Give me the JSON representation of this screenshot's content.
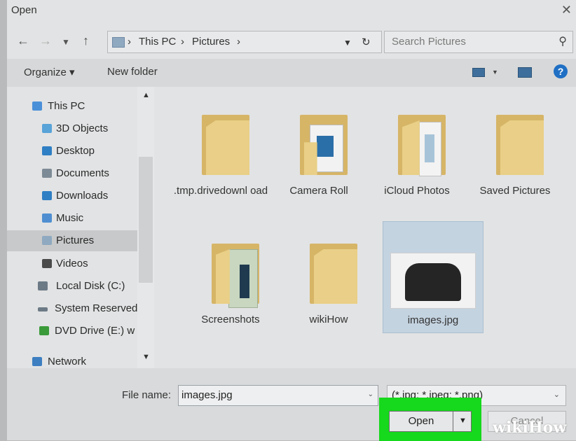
{
  "window": {
    "title": "Open"
  },
  "nav": {
    "breadcrumb": [
      "This PC",
      "Pictures"
    ],
    "search_placeholder": "Search Pictures"
  },
  "toolbar": {
    "organize": "Organize ▾",
    "new_folder": "New folder"
  },
  "sidebar": {
    "items": [
      {
        "label": "This PC",
        "icon": "computer-icon",
        "color": "#4a90d9"
      },
      {
        "label": "3D Objects",
        "icon": "cube-icon",
        "color": "#58a3d8"
      },
      {
        "label": "Desktop",
        "icon": "desktop-icon",
        "color": "#2f7fc4"
      },
      {
        "label": "Documents",
        "icon": "documents-icon",
        "color": "#7d8b96"
      },
      {
        "label": "Downloads",
        "icon": "download-icon",
        "color": "#2f7fc4"
      },
      {
        "label": "Music",
        "icon": "music-icon",
        "color": "#4f8fd1"
      },
      {
        "label": "Pictures",
        "icon": "pictures-icon",
        "color": "#8fa9c0"
      },
      {
        "label": "Videos",
        "icon": "videos-icon",
        "color": "#4a4a4a"
      },
      {
        "label": "Local Disk (C:)",
        "icon": "disk-icon",
        "color": "#6c7a86"
      },
      {
        "label": "System Reserved",
        "icon": "drive-icon",
        "color": "#6c7a86"
      },
      {
        "label": "DVD Drive (E:) w",
        "icon": "dvd-icon",
        "color": "#3a9a3a"
      },
      {
        "label": "Network",
        "icon": "network-icon",
        "color": "#3d7fc1"
      }
    ]
  },
  "files": [
    {
      "name": ".tmp.drivedownl oad",
      "type": "folder"
    },
    {
      "name": "Camera Roll",
      "type": "folder"
    },
    {
      "name": "iCloud Photos",
      "type": "folder"
    },
    {
      "name": "Saved Pictures",
      "type": "folder"
    },
    {
      "name": "Screenshots",
      "type": "folder"
    },
    {
      "name": "wikiHow",
      "type": "folder"
    },
    {
      "name": "images.jpg",
      "type": "image",
      "selected": true
    }
  ],
  "footer": {
    "filename_label": "File name:",
    "filename_value": "images.jpg",
    "filetype_value": "(*.jpg; *.jpeg; *.png)",
    "open_label": "Open",
    "cancel_label": "Cancel"
  },
  "watermark": "wikiHow",
  "colors": {
    "highlight": "#16d81c",
    "folder": "#e9cf87",
    "selection": "#c4d3e0"
  }
}
